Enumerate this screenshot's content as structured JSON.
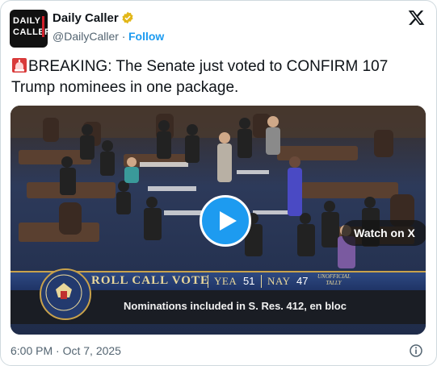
{
  "account": {
    "avatar_line1": "DAILY",
    "avatar_line2": "CALLER",
    "name": "Daily Caller",
    "handle": "@DailyCaller",
    "separator": "·",
    "follow_label": "Follow"
  },
  "post": {
    "text": "BREAKING:  The Senate just voted to CONFIRM 107 Trump nominees in one package.",
    "emoji": "rotating-light-emoji"
  },
  "video": {
    "watch_label": "Watch on X",
    "roll_call": "ROLL CALL VOTE",
    "yea_label": "YEA",
    "yea_count": "51",
    "nay_label": "NAY",
    "nay_count": "47",
    "unofficial": "UNOFFICIAL TALLY",
    "caption": "Nominations included in S. Res. 412, en bloc"
  },
  "footer": {
    "timestamp": "6:00 PM · Oct 7, 2025"
  },
  "colors": {
    "link": "#1d9bf0",
    "text": "#0f1419",
    "muted": "#536471",
    "verified_gold": "#e2b719"
  }
}
